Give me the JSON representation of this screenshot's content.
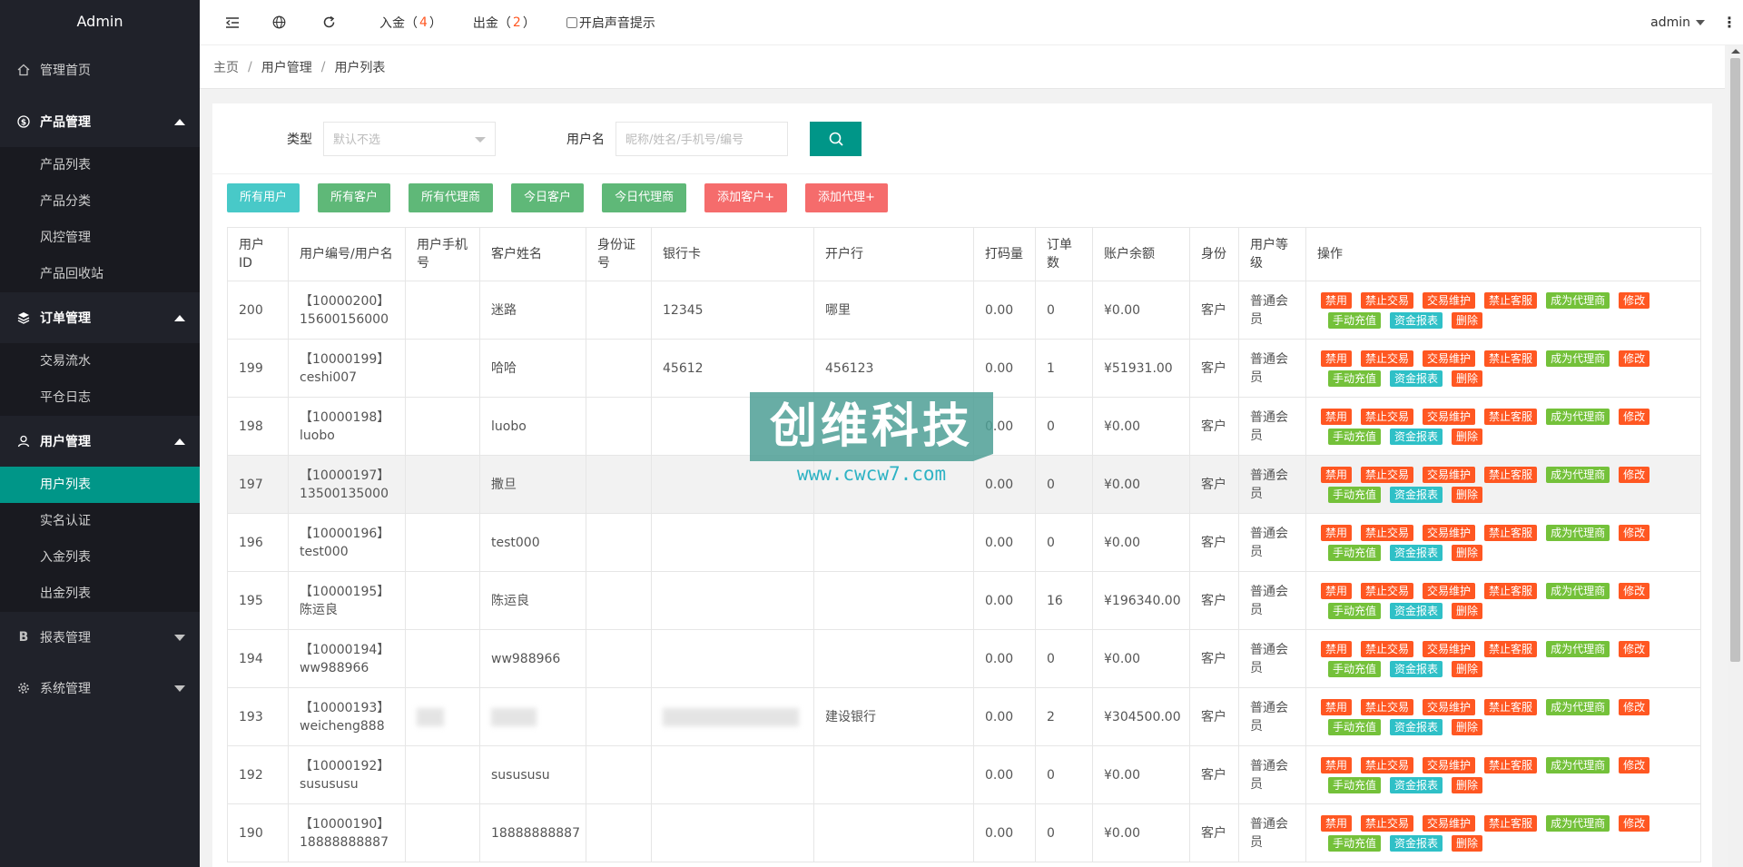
{
  "sidebar": {
    "title": "Admin",
    "home": "管理首页",
    "product": {
      "label": "产品管理",
      "items": [
        "产品列表",
        "产品分类",
        "风控管理",
        "产品回收站"
      ]
    },
    "order": {
      "label": "订单管理",
      "items": [
        "交易流水",
        "平仓日志"
      ]
    },
    "user": {
      "label": "用户管理",
      "items": [
        "用户列表",
        "实名认证",
        "入金列表",
        "出金列表"
      ]
    },
    "report": "报表管理",
    "system": "系统管理"
  },
  "header": {
    "deposit_label": "入金（",
    "deposit_count": "4",
    "withdraw_label": "出金（",
    "withdraw_count": "2",
    "close_paren": "）",
    "sound_label": "开启声音提示",
    "user": "admin"
  },
  "breadcrumb": [
    "主页",
    "用户管理",
    "用户列表"
  ],
  "filter": {
    "type_label": "类型",
    "type_placeholder": "默认不选",
    "username_label": "用户名",
    "username_placeholder": "昵称/姓名/手机号/编号"
  },
  "tabs": [
    "所有用户",
    "所有客户",
    "所有代理商",
    "今日客户",
    "今日代理商",
    "添加客户+",
    "添加代理+"
  ],
  "table": {
    "headers": [
      "用户ID",
      "用户编号/用户名",
      "用户手机号",
      "客户姓名",
      "身份证号",
      "银行卡",
      "开户行",
      "打码量",
      "订单数",
      "账户余额",
      "身份",
      "用户等级",
      "操作"
    ],
    "ops": [
      "禁用",
      "禁止交易",
      "交易维护",
      "禁止客服",
      "成为代理商",
      "修改",
      "手动充值",
      "资金报表",
      "删除"
    ],
    "rows": [
      {
        "id": "200",
        "no": "【10000200】",
        "name": "15600156000",
        "phone": "",
        "cname": "迷路",
        "idcard": "",
        "card": "12345",
        "bank": "哪里",
        "bet": "0.00",
        "orders": "0",
        "balance": "¥0.00",
        "role": "客户",
        "level": "普通会员"
      },
      {
        "id": "199",
        "no": "【10000199】",
        "name": "ceshi007",
        "phone": "",
        "cname": "哈哈",
        "idcard": "",
        "card": "45612",
        "bank": "456123",
        "bet": "0.00",
        "orders": "1",
        "balance": "¥51931.00",
        "role": "客户",
        "level": "普通会员"
      },
      {
        "id": "198",
        "no": "【10000198】",
        "name": "luobo",
        "phone": "",
        "cname": "luobo",
        "idcard": "",
        "card": "",
        "bank": "",
        "bet": "0.00",
        "orders": "0",
        "balance": "¥0.00",
        "role": "客户",
        "level": "普通会员"
      },
      {
        "id": "197",
        "no": "【10000197】",
        "name": "13500135000",
        "phone": "",
        "cname": "撒旦",
        "idcard": "",
        "card": "",
        "bank": "",
        "bet": "0.00",
        "orders": "0",
        "balance": "¥0.00",
        "role": "客户",
        "level": "普通会员"
      },
      {
        "id": "196",
        "no": "【10000196】",
        "name": "test000",
        "phone": "",
        "cname": "test000",
        "idcard": "",
        "card": "",
        "bank": "",
        "bet": "0.00",
        "orders": "0",
        "balance": "¥0.00",
        "role": "客户",
        "level": "普通会员"
      },
      {
        "id": "195",
        "no": "【10000195】",
        "name": "陈运良",
        "phone": "",
        "cname": "陈运良",
        "idcard": "",
        "card": "",
        "bank": "",
        "bet": "0.00",
        "orders": "16",
        "balance": "¥196340.00",
        "role": "客户",
        "level": "普通会员"
      },
      {
        "id": "194",
        "no": "【10000194】",
        "name": "ww988966",
        "phone": "",
        "cname": "ww988966",
        "idcard": "",
        "card": "",
        "bank": "",
        "bet": "0.00",
        "orders": "0",
        "balance": "¥0.00",
        "role": "客户",
        "level": "普通会员"
      },
      {
        "id": "193",
        "no": "【10000193】",
        "name": "weicheng888",
        "phone": "",
        "cname": "",
        "idcard": "",
        "card": "",
        "bank": "建设银行",
        "bet": "0.00",
        "orders": "2",
        "balance": "¥304500.00",
        "role": "客户",
        "level": "普通会员"
      },
      {
        "id": "192",
        "no": "【10000192】",
        "name": "susususu",
        "phone": "",
        "cname": "susususu",
        "idcard": "",
        "card": "",
        "bank": "",
        "bet": "0.00",
        "orders": "0",
        "balance": "¥0.00",
        "role": "客户",
        "level": "普通会员"
      },
      {
        "id": "190",
        "no": "【10000190】",
        "name": "18888888887",
        "phone": "",
        "cname": "18888888887",
        "idcard": "",
        "card": "",
        "bank": "",
        "bet": "0.00",
        "orders": "0",
        "balance": "¥0.00",
        "role": "客户",
        "level": "普通会员"
      }
    ]
  },
  "watermark": {
    "text": "创维科技",
    "url": "www.cwcw7.com"
  }
}
